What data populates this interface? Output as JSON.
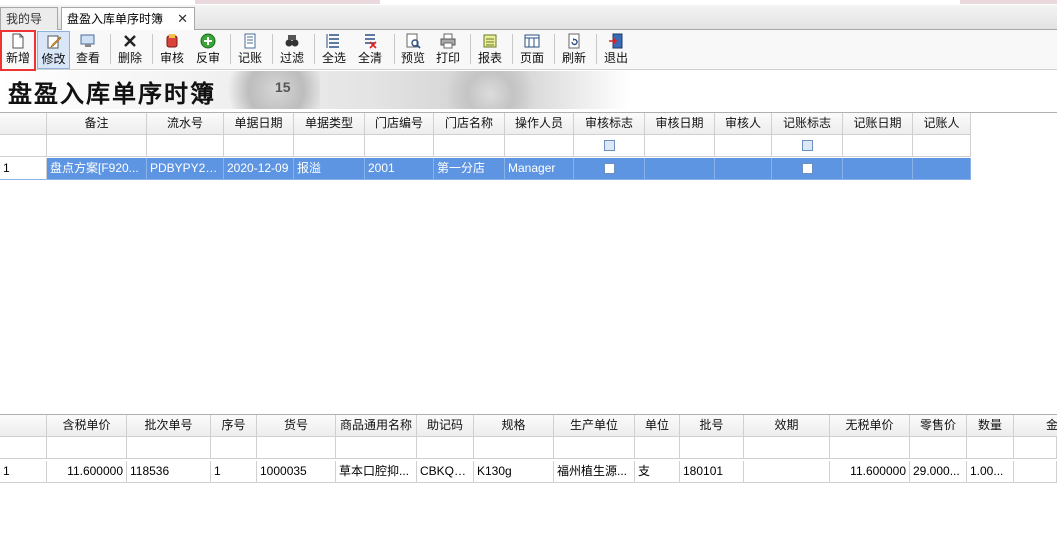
{
  "tabs": {
    "nav_label": "我的导航",
    "active_label": "盘盈入库单序时簿",
    "close_glyph": "✕"
  },
  "toolbar": {
    "buttons": [
      {
        "id": "new",
        "label": "新增",
        "icon": "new-document-icon"
      },
      {
        "id": "edit",
        "label": "修改",
        "icon": "edit-icon"
      },
      {
        "id": "view",
        "label": "查看",
        "icon": "view-icon"
      },
      {
        "id": "delete",
        "label": "删除",
        "icon": "delete-icon"
      },
      {
        "id": "audit",
        "label": "审核",
        "icon": "audit-icon"
      },
      {
        "id": "unaudit",
        "label": "反审",
        "icon": "unaudit-icon"
      },
      {
        "id": "post",
        "label": "记账",
        "icon": "post-icon"
      },
      {
        "id": "filter",
        "label": "过滤",
        "icon": "filter-icon"
      },
      {
        "id": "selectall",
        "label": "全选",
        "icon": "select-all-icon"
      },
      {
        "id": "clearall",
        "label": "全清",
        "icon": "clear-all-icon"
      },
      {
        "id": "preview",
        "label": "预览",
        "icon": "preview-icon"
      },
      {
        "id": "print",
        "label": "打印",
        "icon": "print-icon"
      },
      {
        "id": "report",
        "label": "报表",
        "icon": "report-icon"
      },
      {
        "id": "page",
        "label": "页面",
        "icon": "page-icon"
      },
      {
        "id": "refresh",
        "label": "刷新",
        "icon": "refresh-icon"
      },
      {
        "id": "exit",
        "label": "退出",
        "icon": "exit-icon"
      }
    ]
  },
  "banner": {
    "title": "盘盈入库单序时簿",
    "deco_text": "15"
  },
  "master": {
    "columns": [
      "备注",
      "流水号",
      "单据日期",
      "单据类型",
      "门店编号",
      "门店名称",
      "操作人员",
      "审核标志",
      "审核日期",
      "审核人",
      "记账标志",
      "记账日期",
      "记账人"
    ],
    "rows": [
      {
        "index": "1",
        "remark": "盘点方案[F920...",
        "serial": "PDBYPY20...",
        "date": "2020-12-09",
        "type": "报溢",
        "store_no": "2001",
        "store_name": "第一分店",
        "operator": "Manager",
        "audit_date": "",
        "auditor": "",
        "post_date": "",
        "poster": ""
      }
    ]
  },
  "detail": {
    "columns": [
      "含税单价",
      "批次单号",
      "序号",
      "货号",
      "商品通用名称",
      "助记码",
      "规格",
      "生产单位",
      "单位",
      "批号",
      "效期",
      "无税单价",
      "零售价",
      "数量",
      "金额"
    ],
    "rows": [
      {
        "index": "1",
        "tax_price": "11.600000",
        "batch": "118536",
        "seq": "1",
        "sku": "1000035",
        "name": "草本口腔抑...",
        "code": "CBKQYJG",
        "spec": "K130g",
        "maker": "福州植生源...",
        "unit": "支",
        "lot": "180101",
        "expiry": "",
        "notax_price": "11.600000",
        "retail": "29.000...",
        "qty": "1.00...",
        "amount": ""
      }
    ]
  },
  "colors": {
    "selection": "#5e95e2",
    "highlight_box": "#ee3333"
  }
}
